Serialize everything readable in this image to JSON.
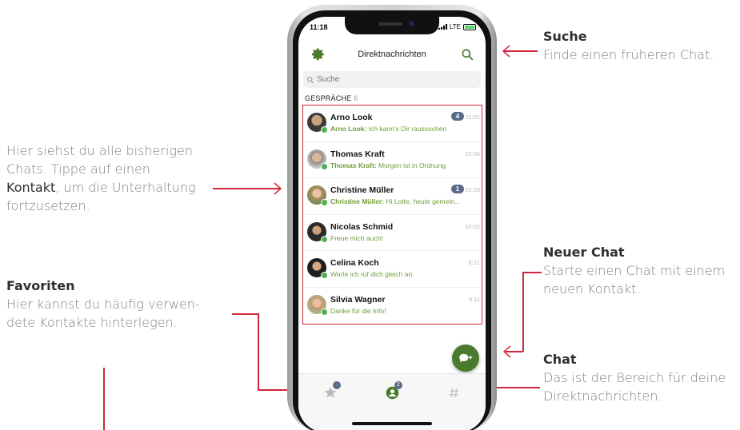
{
  "annotations": {
    "search": {
      "title": "Suche",
      "desc": "Finde einen früheren Chat."
    },
    "overview": {
      "line1": "Hier siehst du alle bisherigen",
      "line2": "Chats. Tippe auf einen",
      "bold": "Kontakt",
      "line3_rest": ", um die Unterhaltung",
      "line4": "fortzusetzen."
    },
    "new_chat": {
      "title": "Neuer Chat",
      "line1": "Starte einen Chat mit einem",
      "line2": "neuen Kontakt."
    },
    "favorites": {
      "title": "Favoriten",
      "line1": "Hier kannst du häufig verwen-",
      "line2": "dete Kontakte hinterlegen."
    },
    "chat": {
      "title": "Chat",
      "line1": "Das ist der Bereich für deine",
      "line2": "Direktnachrichten."
    }
  },
  "colors": {
    "accent_red": "#d0263a",
    "brand_green": "#4a7a2e",
    "badge": "#5a6b86",
    "online": "#4fb04f"
  },
  "status_bar": {
    "time": "11:18",
    "network": "LTE"
  },
  "header": {
    "title": "Direktnachrichten",
    "left_icon": "gear-icon",
    "right_icon": "search-icon"
  },
  "search": {
    "placeholder": "Suche"
  },
  "section": {
    "label": "GESPRÄCHE",
    "count": "6"
  },
  "conversations": [
    {
      "name": "Arno Look",
      "sender": "Arno Look:",
      "text": " Ich kann's Dir raussuchen",
      "time": "11:01",
      "unread": "4"
    },
    {
      "name": "Thomas Kraft",
      "sender": "Thomas Kraft:",
      "text": " Morgen ist in Ordnung",
      "time": "10:56",
      "unread": ""
    },
    {
      "name": "Christine Müller",
      "sender": "Christine Müller:",
      "text": " Hi Lotte, heute gemein...",
      "time": "10:39",
      "unread": "1"
    },
    {
      "name": "Nicolas Schmid",
      "sender": "",
      "text": "Freue mich auch!",
      "time": "10:02",
      "unread": ""
    },
    {
      "name": "Celina Koch",
      "sender": "",
      "text": "Warte ich ruf dich gleich an",
      "time": "8:21",
      "unread": ""
    },
    {
      "name": "Silvia Wagner",
      "sender": "",
      "text": "Danke für die Info!",
      "time": "8:11",
      "unread": ""
    }
  ],
  "tabbar": {
    "favorites_icon": "star-icon",
    "direct_icon": "person-icon",
    "direct_badge": "2",
    "channels_icon": "hash-icon"
  },
  "fab": {
    "icon": "new-chat-icon"
  }
}
